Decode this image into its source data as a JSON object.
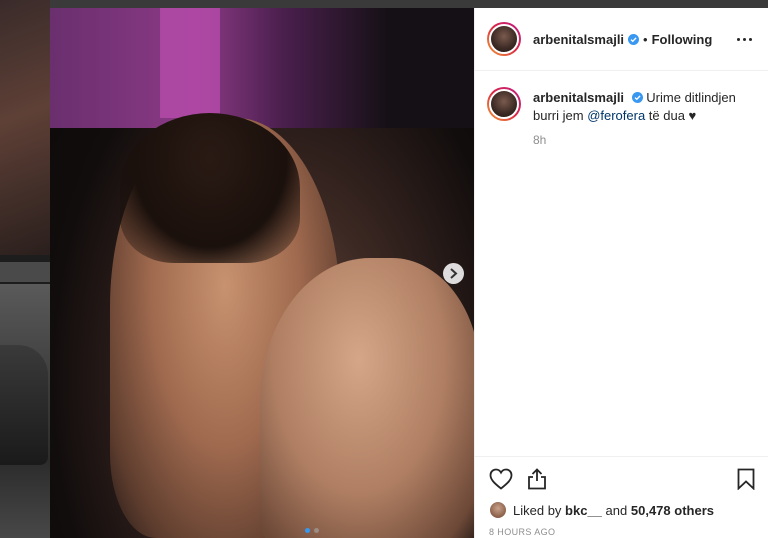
{
  "post": {
    "username": "arbenitalsmajli",
    "follow_separator": "•",
    "follow_status": "Following"
  },
  "caption": {
    "username": "arbenitalsmajli",
    "text_before": "Urime ditlindjen burri jem ",
    "mention": "@ferofera",
    "text_after": " të dua ♥",
    "time": "8h"
  },
  "likes": {
    "prefix": "Liked by ",
    "user": "bkc__",
    "middle": " and ",
    "count": "50,478 others"
  },
  "timestamp": "8 HOURS AGO",
  "carousel": {
    "total": 2,
    "current": 1
  },
  "icons": {
    "verified": "verified-badge-icon",
    "more": "more-options-icon",
    "like": "heart-icon",
    "share": "share-icon",
    "save": "bookmark-icon",
    "next": "chevron-right-icon"
  },
  "colors": {
    "verified": "#3897f0",
    "mention": "#003569",
    "muted": "#8e8e8e"
  }
}
